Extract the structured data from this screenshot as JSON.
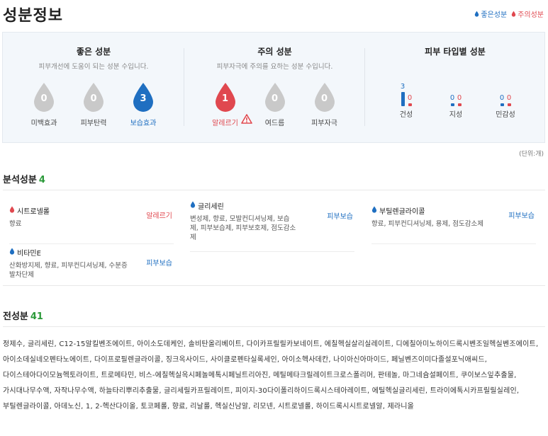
{
  "header": {
    "title": "성분정보",
    "legend_good": "좋은성분",
    "legend_warn": "주의성분"
  },
  "colors": {
    "good": "#1f6fc1",
    "warn": "#e0484f",
    "count": "#2c9a3a",
    "neutral_drop": "#c9c9c9"
  },
  "good_ingredients": {
    "title": "좋은 성분",
    "subtitle": "피부개선에 도움이 되는 성분 수입니다.",
    "items": [
      {
        "label": "미백효과",
        "count": "0",
        "state": "neutral"
      },
      {
        "label": "피부탄력",
        "count": "0",
        "state": "neutral"
      },
      {
        "label": "보습효과",
        "count": "3",
        "state": "good"
      }
    ]
  },
  "caution_ingredients": {
    "title": "주의 성분",
    "subtitle": "피부자극에 주의를 요하는 성분 수입니다.",
    "items": [
      {
        "label": "알레르기",
        "count": "1",
        "state": "warn"
      },
      {
        "label": "여드름",
        "count": "0",
        "state": "neutral"
      },
      {
        "label": "피부자극",
        "count": "0",
        "state": "neutral"
      }
    ]
  },
  "skin_types": {
    "title": "피부 타입별 성분",
    "items": [
      {
        "label": "건성",
        "good": 3,
        "warn": 0
      },
      {
        "label": "지성",
        "good": 0,
        "warn": 0
      },
      {
        "label": "민감성",
        "good": 0,
        "warn": 0
      }
    ]
  },
  "unit": "(단위:개)",
  "analysis": {
    "title": "분석성분",
    "count": "4",
    "items": [
      {
        "name": "시트로넬롤",
        "desc": "향료",
        "tag": "알레르기",
        "kind": "warn"
      },
      {
        "name": "글리세린",
        "desc": "변성제, 향료, 모발컨디셔닝제, 보습제, 피부보습제, 피부보호제, 점도감소제",
        "tag": "피부보습",
        "kind": "good"
      },
      {
        "name": "부틸렌글라이콜",
        "desc": "향료, 피부컨디셔닝제, 용제, 점도감소제",
        "tag": "피부보습",
        "kind": "good"
      },
      {
        "name": "비타민E",
        "desc": "산화방지제, 향료, 피부컨디셔닝제, 수분증발차단제",
        "tag": "피부보습",
        "kind": "good"
      }
    ]
  },
  "all_ingredients": {
    "title": "전성분",
    "count": "41",
    "text": "정제수, 글리세린, C12-15알킬벤조에이트, 아이소도데케인, 솔비탄올리베이트, 다이카프릴릴카보네이트, 에칠헥실살리실레이트, 디에칠아미노하이드록시벤조일헥실벤조에이트, 아이소데실네오펜타노에이트, 다이프로필렌글라이콜, 징크옥사이드, 사이클로펜타실록세인, 아이소헥사데칸, 나이아신아마이드, 페닐벤즈이미다졸설포닉애씨드, 다이스테아다이모늄헥토라이트, 트로메타민, 비스-에칠헥실옥시페놀메톡시페닐트리아진, 메틸메타크릴레이트크로스폴리머, 판테놀, 마그네슘설페이트, 쿠이보스잎추출물, 가시대나무수액, 자작나무수액, 하늘타리뿌리추출물, 글리세릴카프릴레이트, 피이지-30다이폴리하이드록시스테아레이트, 에틸헥실글리세린, 트라이에톡시카프릴릴실레인, 부틸렌글라이콜, 아데노신, 1, 2-헥산다이올, 토코페롤, 향료, 리날룰, 헥실신남알, 리모넨, 시트로넬롤, 하이드록시시트로넬알, 제라니올"
  }
}
